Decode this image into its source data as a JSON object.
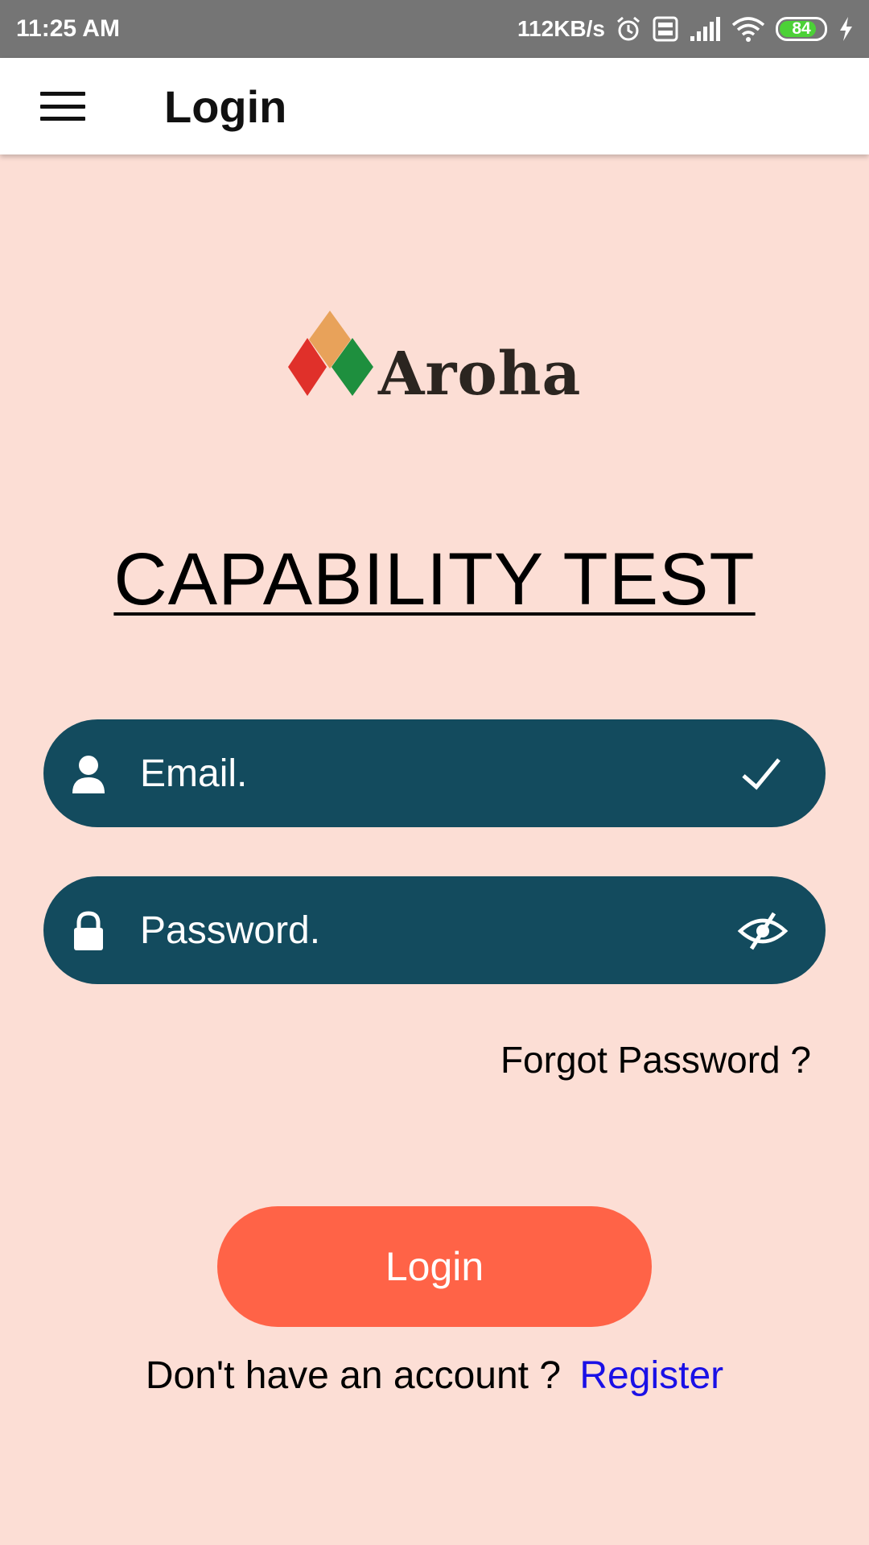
{
  "status_bar": {
    "time": "11:25 AM",
    "net_speed": "112KB/s",
    "battery_level": "84",
    "battery_fraction": 0.84,
    "icons": [
      "alarm-icon",
      "volte-icon",
      "signal-icon",
      "wifi-icon",
      "battery-icon",
      "charging-icon"
    ]
  },
  "app_bar": {
    "title": "Login",
    "menu_icon": "hamburger-menu-icon"
  },
  "logo": {
    "text": "Aroha",
    "colors": [
      "#e8a25a",
      "#e0302a",
      "#1e8f3e"
    ]
  },
  "page": {
    "title": "CAPABILITY TEST"
  },
  "form": {
    "email": {
      "placeholder": "Email.",
      "value": "",
      "lead_icon": "user-icon",
      "trail_icon": "check-icon"
    },
    "password": {
      "placeholder": "Password.",
      "value": "",
      "lead_icon": "lock-icon",
      "trail_icon": "eye-off-icon"
    },
    "forgot_label": "Forgot Password ?",
    "login_label": "Login",
    "register_prompt": "Don't have an account ?",
    "register_link": "Register"
  },
  "colors": {
    "background": "#fcded5",
    "field_bg": "#134b5e",
    "button_bg": "#ff6347",
    "link": "#1a10e6",
    "status_bar": "#757575"
  }
}
